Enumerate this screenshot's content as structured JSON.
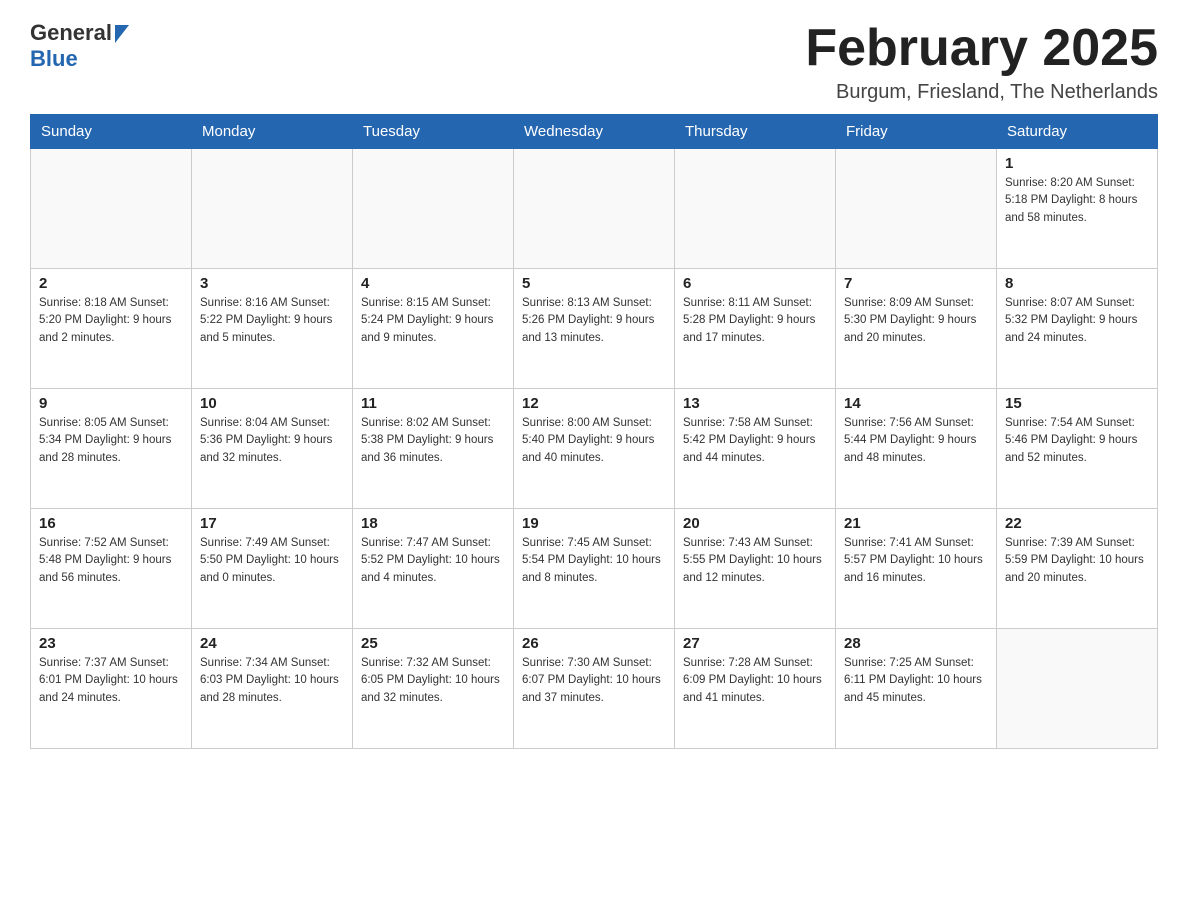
{
  "header": {
    "logo_general": "General",
    "logo_blue": "Blue",
    "month_title": "February 2025",
    "location": "Burgum, Friesland, The Netherlands"
  },
  "days_of_week": [
    "Sunday",
    "Monday",
    "Tuesday",
    "Wednesday",
    "Thursday",
    "Friday",
    "Saturday"
  ],
  "weeks": [
    {
      "days": [
        {
          "number": "",
          "info": ""
        },
        {
          "number": "",
          "info": ""
        },
        {
          "number": "",
          "info": ""
        },
        {
          "number": "",
          "info": ""
        },
        {
          "number": "",
          "info": ""
        },
        {
          "number": "",
          "info": ""
        },
        {
          "number": "1",
          "info": "Sunrise: 8:20 AM\nSunset: 5:18 PM\nDaylight: 8 hours and 58 minutes."
        }
      ]
    },
    {
      "days": [
        {
          "number": "2",
          "info": "Sunrise: 8:18 AM\nSunset: 5:20 PM\nDaylight: 9 hours and 2 minutes."
        },
        {
          "number": "3",
          "info": "Sunrise: 8:16 AM\nSunset: 5:22 PM\nDaylight: 9 hours and 5 minutes."
        },
        {
          "number": "4",
          "info": "Sunrise: 8:15 AM\nSunset: 5:24 PM\nDaylight: 9 hours and 9 minutes."
        },
        {
          "number": "5",
          "info": "Sunrise: 8:13 AM\nSunset: 5:26 PM\nDaylight: 9 hours and 13 minutes."
        },
        {
          "number": "6",
          "info": "Sunrise: 8:11 AM\nSunset: 5:28 PM\nDaylight: 9 hours and 17 minutes."
        },
        {
          "number": "7",
          "info": "Sunrise: 8:09 AM\nSunset: 5:30 PM\nDaylight: 9 hours and 20 minutes."
        },
        {
          "number": "8",
          "info": "Sunrise: 8:07 AM\nSunset: 5:32 PM\nDaylight: 9 hours and 24 minutes."
        }
      ]
    },
    {
      "days": [
        {
          "number": "9",
          "info": "Sunrise: 8:05 AM\nSunset: 5:34 PM\nDaylight: 9 hours and 28 minutes."
        },
        {
          "number": "10",
          "info": "Sunrise: 8:04 AM\nSunset: 5:36 PM\nDaylight: 9 hours and 32 minutes."
        },
        {
          "number": "11",
          "info": "Sunrise: 8:02 AM\nSunset: 5:38 PM\nDaylight: 9 hours and 36 minutes."
        },
        {
          "number": "12",
          "info": "Sunrise: 8:00 AM\nSunset: 5:40 PM\nDaylight: 9 hours and 40 minutes."
        },
        {
          "number": "13",
          "info": "Sunrise: 7:58 AM\nSunset: 5:42 PM\nDaylight: 9 hours and 44 minutes."
        },
        {
          "number": "14",
          "info": "Sunrise: 7:56 AM\nSunset: 5:44 PM\nDaylight: 9 hours and 48 minutes."
        },
        {
          "number": "15",
          "info": "Sunrise: 7:54 AM\nSunset: 5:46 PM\nDaylight: 9 hours and 52 minutes."
        }
      ]
    },
    {
      "days": [
        {
          "number": "16",
          "info": "Sunrise: 7:52 AM\nSunset: 5:48 PM\nDaylight: 9 hours and 56 minutes."
        },
        {
          "number": "17",
          "info": "Sunrise: 7:49 AM\nSunset: 5:50 PM\nDaylight: 10 hours and 0 minutes."
        },
        {
          "number": "18",
          "info": "Sunrise: 7:47 AM\nSunset: 5:52 PM\nDaylight: 10 hours and 4 minutes."
        },
        {
          "number": "19",
          "info": "Sunrise: 7:45 AM\nSunset: 5:54 PM\nDaylight: 10 hours and 8 minutes."
        },
        {
          "number": "20",
          "info": "Sunrise: 7:43 AM\nSunset: 5:55 PM\nDaylight: 10 hours and 12 minutes."
        },
        {
          "number": "21",
          "info": "Sunrise: 7:41 AM\nSunset: 5:57 PM\nDaylight: 10 hours and 16 minutes."
        },
        {
          "number": "22",
          "info": "Sunrise: 7:39 AM\nSunset: 5:59 PM\nDaylight: 10 hours and 20 minutes."
        }
      ]
    },
    {
      "days": [
        {
          "number": "23",
          "info": "Sunrise: 7:37 AM\nSunset: 6:01 PM\nDaylight: 10 hours and 24 minutes."
        },
        {
          "number": "24",
          "info": "Sunrise: 7:34 AM\nSunset: 6:03 PM\nDaylight: 10 hours and 28 minutes."
        },
        {
          "number": "25",
          "info": "Sunrise: 7:32 AM\nSunset: 6:05 PM\nDaylight: 10 hours and 32 minutes."
        },
        {
          "number": "26",
          "info": "Sunrise: 7:30 AM\nSunset: 6:07 PM\nDaylight: 10 hours and 37 minutes."
        },
        {
          "number": "27",
          "info": "Sunrise: 7:28 AM\nSunset: 6:09 PM\nDaylight: 10 hours and 41 minutes."
        },
        {
          "number": "28",
          "info": "Sunrise: 7:25 AM\nSunset: 6:11 PM\nDaylight: 10 hours and 45 minutes."
        },
        {
          "number": "",
          "info": ""
        }
      ]
    }
  ]
}
